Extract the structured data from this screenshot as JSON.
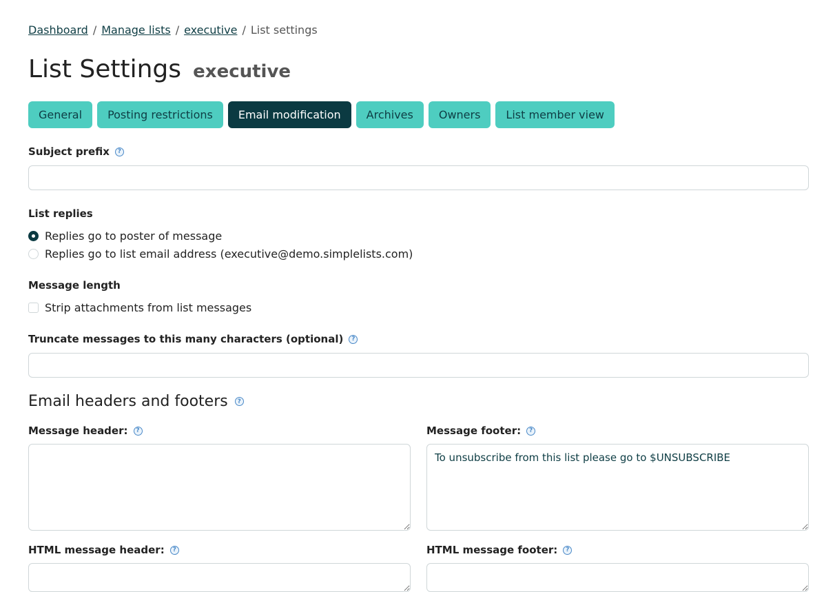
{
  "breadcrumb": {
    "items": [
      "Dashboard",
      "Manage lists",
      "executive"
    ],
    "current": "List settings",
    "separator": "/"
  },
  "title": {
    "main": "List Settings",
    "sub": "executive"
  },
  "tabs": [
    {
      "label": "General",
      "active": false
    },
    {
      "label": "Posting restrictions",
      "active": false
    },
    {
      "label": "Email modification",
      "active": true
    },
    {
      "label": "Archives",
      "active": false
    },
    {
      "label": "Owners",
      "active": false
    },
    {
      "label": "List member view",
      "active": false
    }
  ],
  "subject_prefix": {
    "label": "Subject prefix",
    "value": ""
  },
  "list_replies": {
    "label": "List replies",
    "options": [
      {
        "label": "Replies go to poster of message",
        "checked": true
      },
      {
        "label": "Replies go to list email address (executive@demo.simplelists.com)",
        "checked": false
      }
    ]
  },
  "message_length": {
    "label": "Message length",
    "strip_attachments": {
      "label": "Strip attachments from list messages",
      "checked": false
    },
    "truncate_label": "Truncate messages to this many characters (optional)",
    "truncate_value": ""
  },
  "headers_footers": {
    "title": "Email headers and footers",
    "message_header": {
      "label": "Message header:",
      "value": ""
    },
    "message_footer": {
      "label": "Message footer:",
      "value": "To unsubscribe from this list please go to $UNSUBSCRIBE"
    },
    "html_message_header": {
      "label": "HTML message header:",
      "value": ""
    },
    "html_message_footer": {
      "label": "HTML message footer:",
      "value": ""
    }
  },
  "icons": {
    "help": "question-mark-icon"
  },
  "colors": {
    "accent": "#4ecdc0",
    "active_tab": "#0b3a42",
    "link": "#0e3d44"
  }
}
